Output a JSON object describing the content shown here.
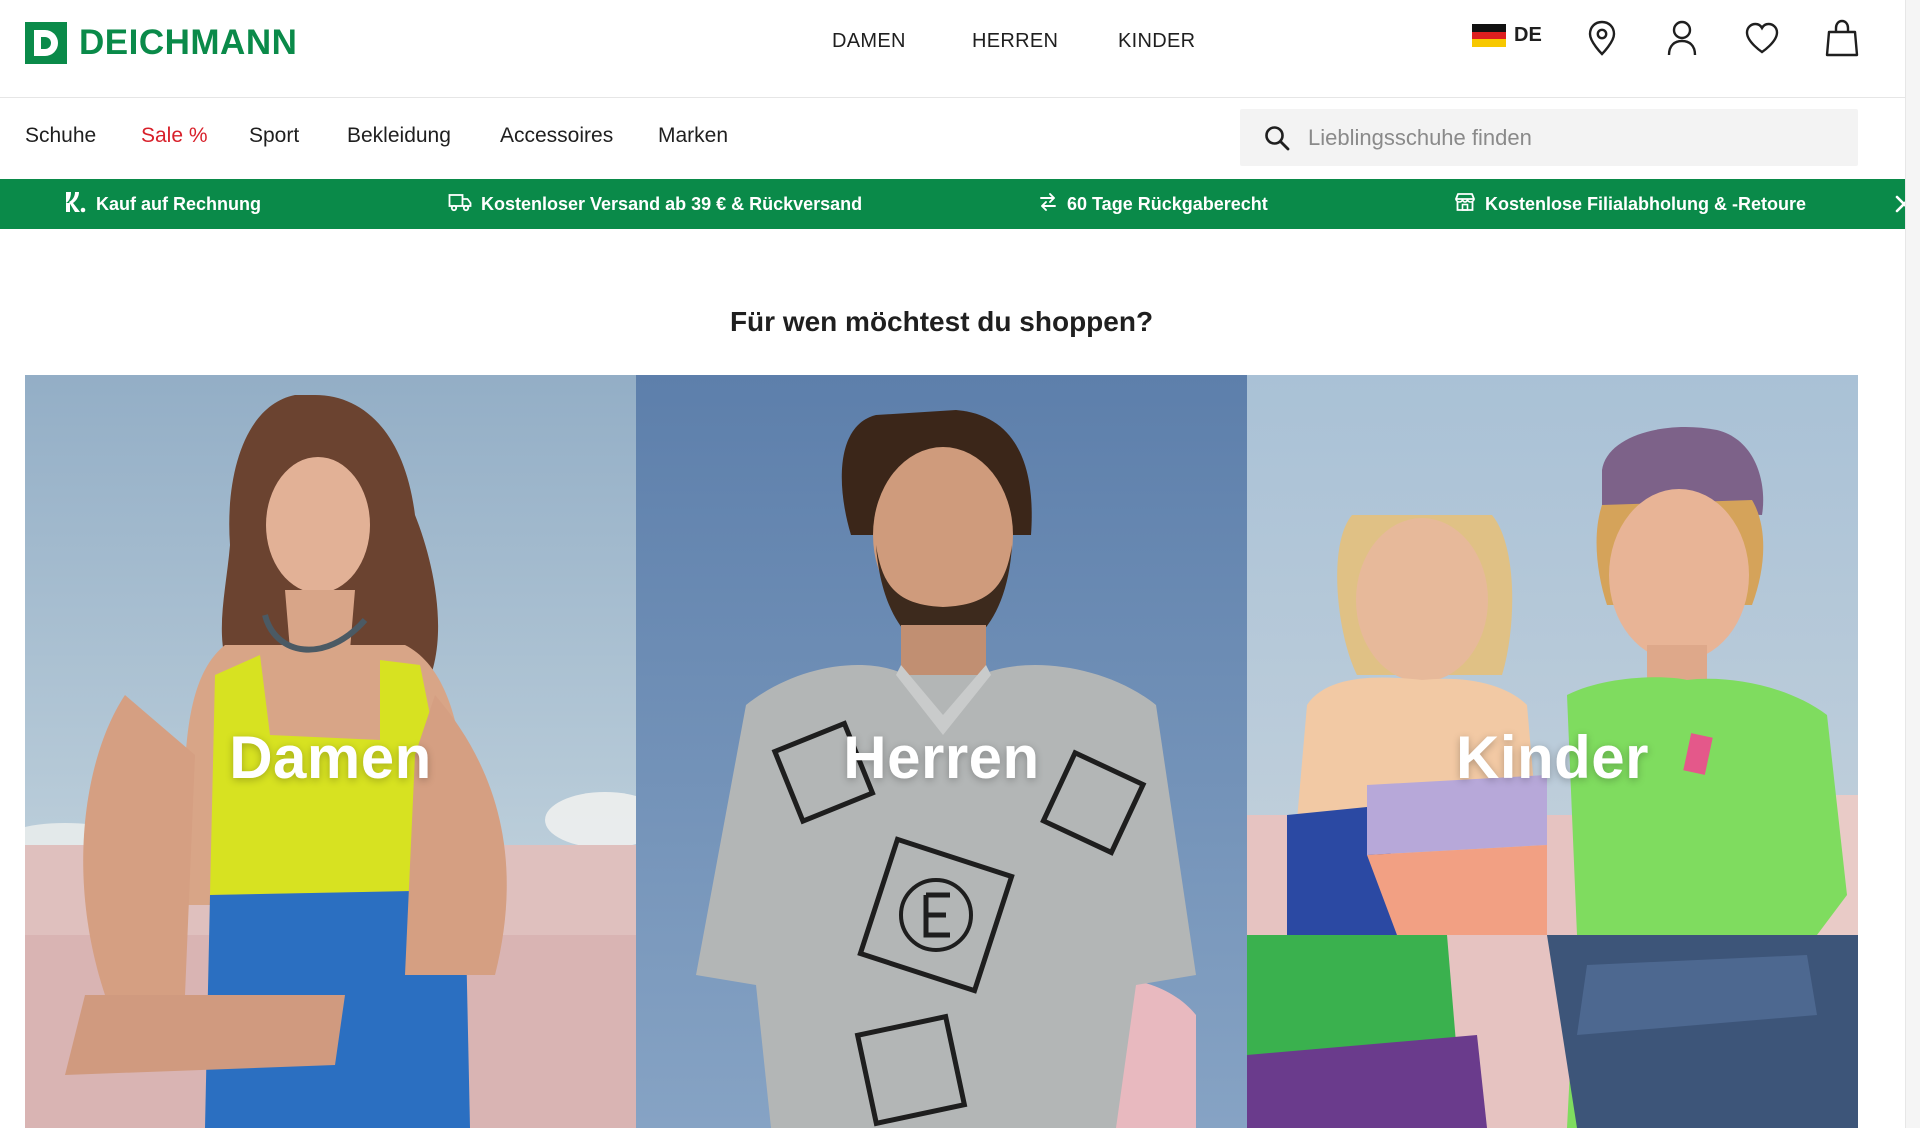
{
  "brand": {
    "name": "DEICHMANN",
    "color": "#0a8a49"
  },
  "main_nav": {
    "items": [
      "DAMEN",
      "HERREN",
      "KINDER"
    ]
  },
  "utilities": {
    "country": "DE",
    "icons": [
      "location-pin-icon",
      "user-icon",
      "heart-icon",
      "shopping-bag-icon"
    ]
  },
  "categories": {
    "items": [
      {
        "label": "Schuhe",
        "highlight": false
      },
      {
        "label": "Sale %",
        "highlight": true,
        "color": "#d8202a"
      },
      {
        "label": "Sport",
        "highlight": false
      },
      {
        "label": "Bekleidung",
        "highlight": false
      },
      {
        "label": "Accessoires",
        "highlight": false
      },
      {
        "label": "Marken",
        "highlight": false
      }
    ]
  },
  "search": {
    "placeholder": "Lieblingsschuhe finden",
    "value": ""
  },
  "usp": {
    "items": [
      {
        "icon": "klarna-k-icon",
        "label": "Kauf auf Rechnung"
      },
      {
        "icon": "truck-icon",
        "label": "Kostenloser Versand ab 39 € & Rückversand"
      },
      {
        "icon": "arrows-exchange-icon",
        "label": "60 Tage Rückgaberecht"
      },
      {
        "icon": "store-icon",
        "label": "Kostenlose Filialabholung & -Retoure"
      }
    ],
    "close_icon": "close-icon"
  },
  "main": {
    "question": "Für wen möchtest du shoppen?",
    "tiles": [
      {
        "label": "Damen"
      },
      {
        "label": "Herren"
      },
      {
        "label": "Kinder"
      }
    ]
  }
}
